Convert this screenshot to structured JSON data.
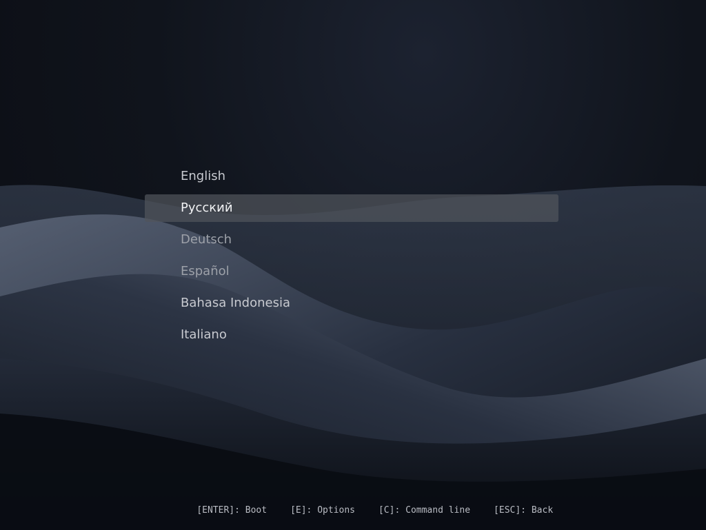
{
  "boot_menu": {
    "items": [
      {
        "label": "English"
      },
      {
        "label": "Русский",
        "selected": true
      },
      {
        "label": "Deutsch"
      },
      {
        "label": "Español"
      },
      {
        "label": "Bahasa Indonesia"
      },
      {
        "label": "Italiano"
      }
    ],
    "selected_index": 1
  },
  "footer": {
    "hints": [
      "[ENTER]: Boot",
      "[E]: Options",
      "[C]: Command line",
      "[ESC]: Back"
    ]
  },
  "colors": {
    "background": "#0b0e15",
    "selection": "#50545c",
    "text": "#c8cad0"
  }
}
